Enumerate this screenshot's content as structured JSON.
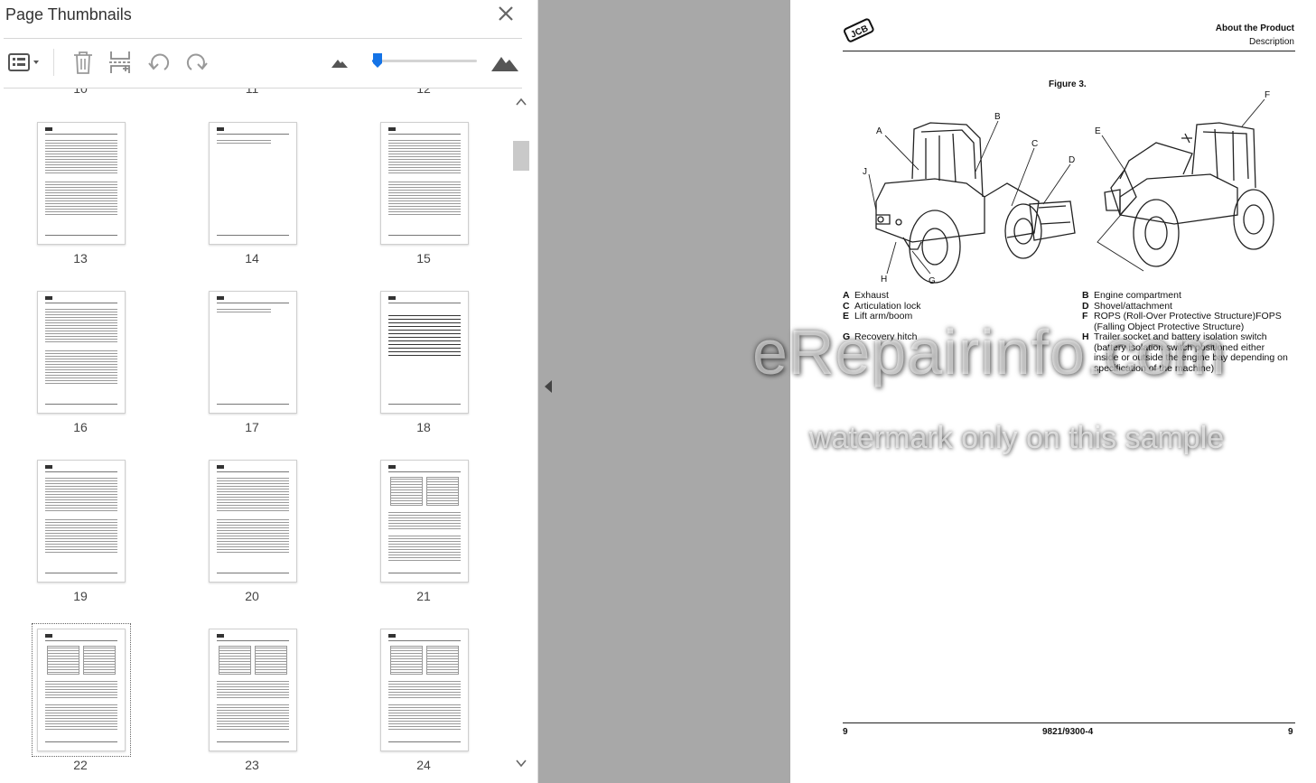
{
  "panel": {
    "title": "Page Thumbnails",
    "close_icon": "close-icon",
    "toolbar": {
      "options_icon": "thumbnail-options-icon",
      "delete_icon": "trash-icon",
      "insert_icon": "insert-pages-icon",
      "undo_icon": "undo-icon",
      "redo_icon": "redo-icon",
      "zoom_out_icon": "small-mountain-icon",
      "zoom_in_icon": "large-mountain-icon",
      "zoom_level": 0.05
    },
    "partial_row_numbers": [
      "10",
      "11",
      "12"
    ],
    "thumbnails": [
      {
        "num": "13"
      },
      {
        "num": "14"
      },
      {
        "num": "15"
      },
      {
        "num": "16"
      },
      {
        "num": "17"
      },
      {
        "num": "18"
      },
      {
        "num": "19"
      },
      {
        "num": "20"
      },
      {
        "num": "21"
      },
      {
        "num": "22",
        "selected": true
      },
      {
        "num": "23"
      },
      {
        "num": "24"
      }
    ]
  },
  "page": {
    "logo_text": "JCB",
    "header_title": "About the Product",
    "header_subtitle": "Description",
    "figure_label": "Figure 3.",
    "callouts": [
      "A",
      "B",
      "C",
      "D",
      "E",
      "F",
      "G",
      "H",
      "J"
    ],
    "legend_left": [
      {
        "key": "A",
        "text": "Exhaust"
      },
      {
        "key": "C",
        "text": "Articulation lock"
      },
      {
        "key": "E",
        "text": "Lift arm/boom"
      },
      {
        "key": "G",
        "text": "Recovery hitch"
      }
    ],
    "legend_right": [
      {
        "key": "B",
        "text": "Engine compartment"
      },
      {
        "key": "D",
        "text": "Shovel/attachment"
      },
      {
        "key": "F",
        "text": "ROPS (Roll-Over Protective Structure)FOPS",
        "cont": "(Falling Object Protective Structure)"
      },
      {
        "key": "H",
        "text": "Trailer socket and battery isolation switch",
        "cont": "(battery isolation switch positioned either inside or outside the engine bay depending on specification of the machine)"
      }
    ],
    "watermark_main": "eRepairinfo.com",
    "watermark_sub": "watermark only on this sample",
    "footer_left": "9",
    "footer_center": "9821/9300-4",
    "footer_right": "9"
  }
}
